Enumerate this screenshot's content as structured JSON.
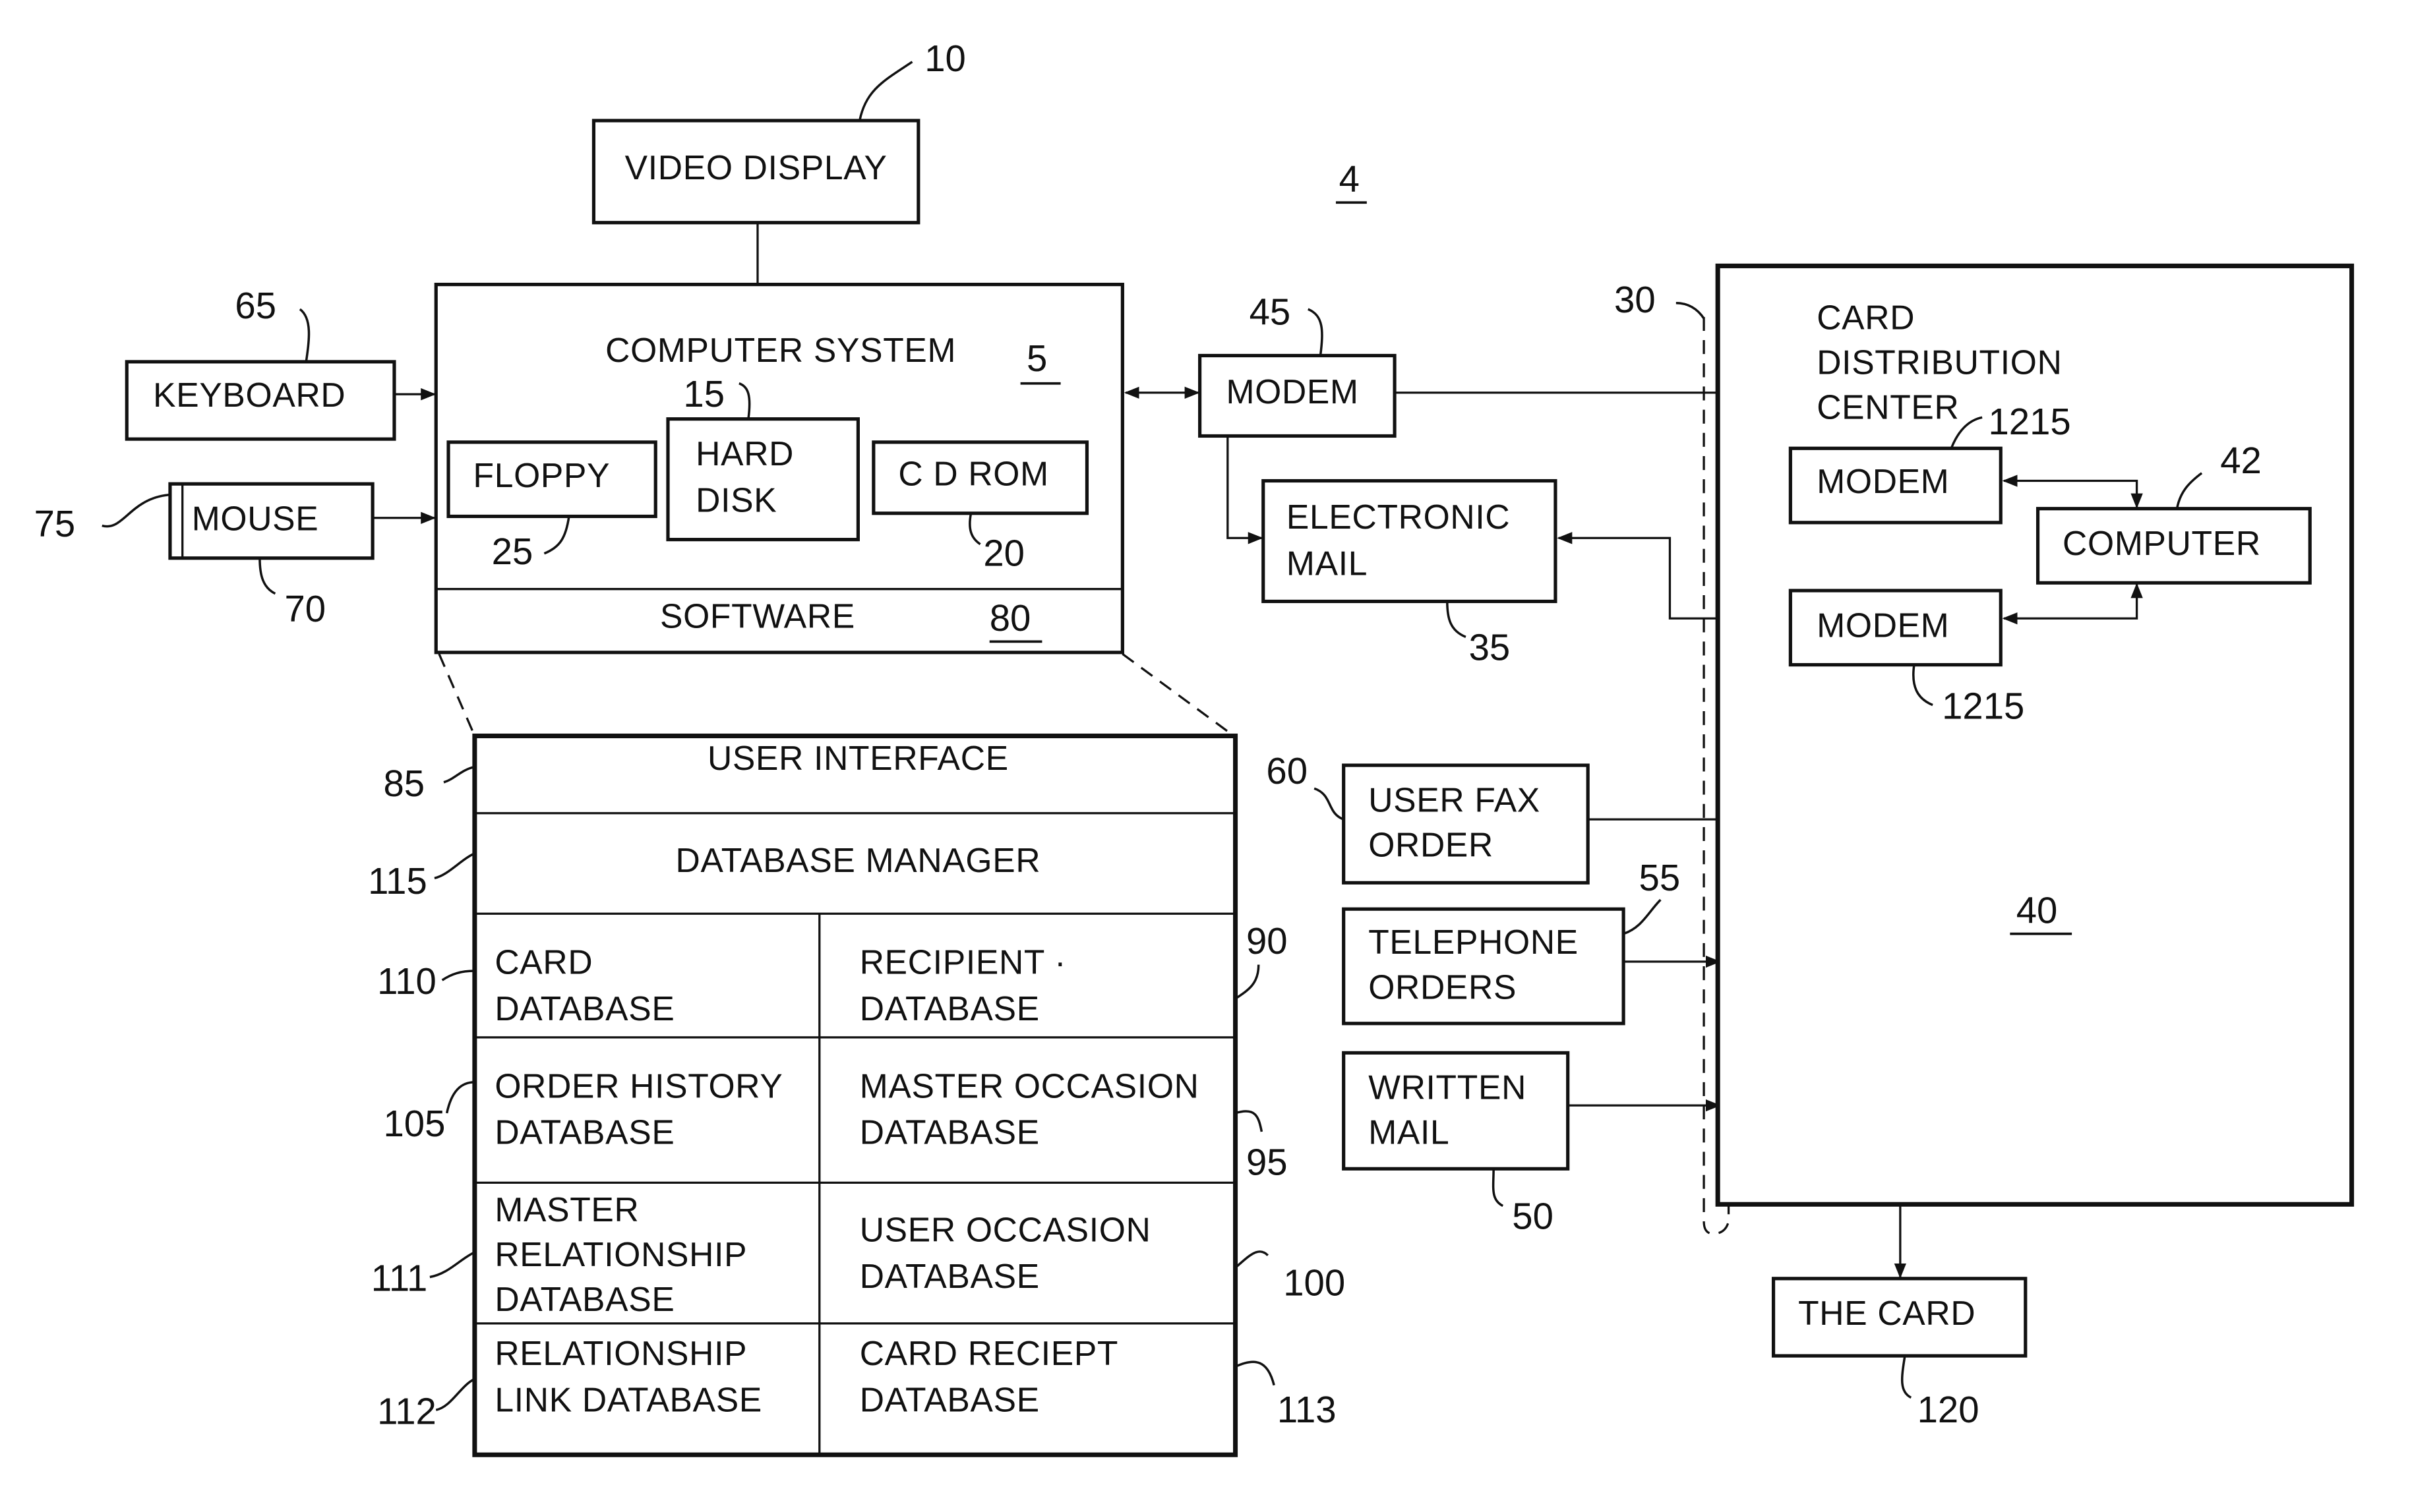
{
  "figure": {
    "figure_number": "4",
    "nodes": {
      "video_display": {
        "label": "VIDEO DISPLAY",
        "ref": "10"
      },
      "computer_system": {
        "label": "COMPUTER SYSTEM",
        "ref": "5"
      },
      "hard_disk": {
        "label_line1": "HARD",
        "label_line2": "DISK",
        "ref": "15"
      },
      "floppy": {
        "label": "FLOPPY",
        "ref": "25"
      },
      "cd_rom": {
        "label": "C D ROM",
        "ref": "20"
      },
      "software": {
        "label": "SOFTWARE",
        "ref": "80"
      },
      "keyboard": {
        "label": "KEYBOARD",
        "ref": "65"
      },
      "mouse": {
        "label": "MOUSE",
        "ref": "70",
        "ref_button": "75"
      },
      "modem_user": {
        "label": "MODEM",
        "ref": "45"
      },
      "electronic_mail": {
        "label_line1": "ELECTRONIC",
        "label_line2": "MAIL",
        "ref": "35"
      },
      "user_fax_order": {
        "label_line1": "USER FAX",
        "label_line2": "ORDER",
        "ref": "60"
      },
      "telephone_orders": {
        "label_line1": "TELEPHONE",
        "label_line2": "ORDERS",
        "ref": "55"
      },
      "written_mail": {
        "label_line1": "WRITTEN",
        "label_line2": "MAIL",
        "ref": "50"
      },
      "network": {
        "ref": "30"
      },
      "card_distribution_center": {
        "label_line1": "CARD",
        "label_line2": "DISTRIBUTION",
        "label_line3": "CENTER",
        "ref": "40"
      },
      "modem_cdc_top": {
        "label": "MODEM",
        "ref": "1215"
      },
      "modem_cdc_bottom": {
        "label": "MODEM",
        "ref": "1215"
      },
      "computer_cdc": {
        "label": "COMPUTER",
        "ref": "42"
      },
      "the_card": {
        "label": "THE CARD",
        "ref": "120"
      }
    },
    "software_stack": {
      "user_interface": {
        "label": "USER INTERFACE",
        "ref": "85"
      },
      "database_manager": {
        "label": "DATABASE MANAGER",
        "ref": "115"
      },
      "databases": [
        {
          "line1": "CARD",
          "line2": "DATABASE",
          "ref": "110"
        },
        {
          "line1": "RECIPIENT ·",
          "line2": "DATABASE",
          "ref": "90"
        },
        {
          "line1": "ORDER HISTORY",
          "line2": "DATABASE",
          "ref": "105"
        },
        {
          "line1": "MASTER OCCASION",
          "line2": "DATABASE",
          "ref": "95"
        },
        {
          "line1": "MASTER",
          "line2": "RELATIONSHIP",
          "line3": "DATABASE",
          "ref": "111"
        },
        {
          "line1": "USER OCCASION",
          "line2": "DATABASE",
          "ref": "100"
        },
        {
          "line1": "RELATIONSHIP",
          "line2": "LINK DATABASE",
          "ref": "112"
        },
        {
          "line1": "CARD RECIEPT",
          "line2": "DATABASE",
          "ref": "113"
        }
      ]
    }
  }
}
